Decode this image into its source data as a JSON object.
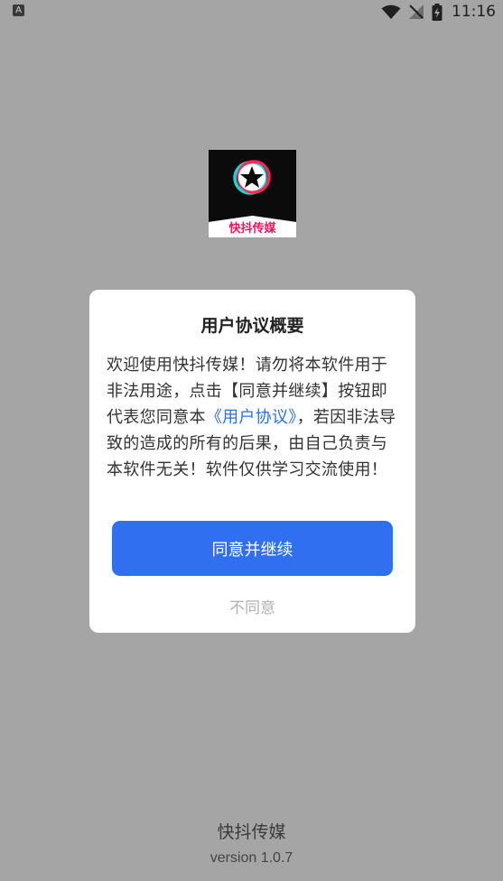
{
  "status_bar": {
    "time": "11:16",
    "left_icon_label": "A"
  },
  "logo": {
    "text": "快抖传媒"
  },
  "dialog": {
    "title": "用户协议概要",
    "body_before_link": "欢迎使用快抖传媒！请勿将本软件用于非法用途，点击【同意并继续】按钮即代表您同意本",
    "link_text": "《用户协议》",
    "body_after_link": "，若因非法导致的造成的所有的后果，由自己负责与本软件无关！软件仅供学习交流使用！",
    "agree_label": "同意并继续",
    "disagree_label": "不同意"
  },
  "footer": {
    "app_name": "快抖传媒",
    "version": "version 1.0.7"
  },
  "colors": {
    "background": "#a5a5a5",
    "primary": "#2f6ff0",
    "link": "#2a6fe8",
    "logo_text": "#e8195a"
  }
}
